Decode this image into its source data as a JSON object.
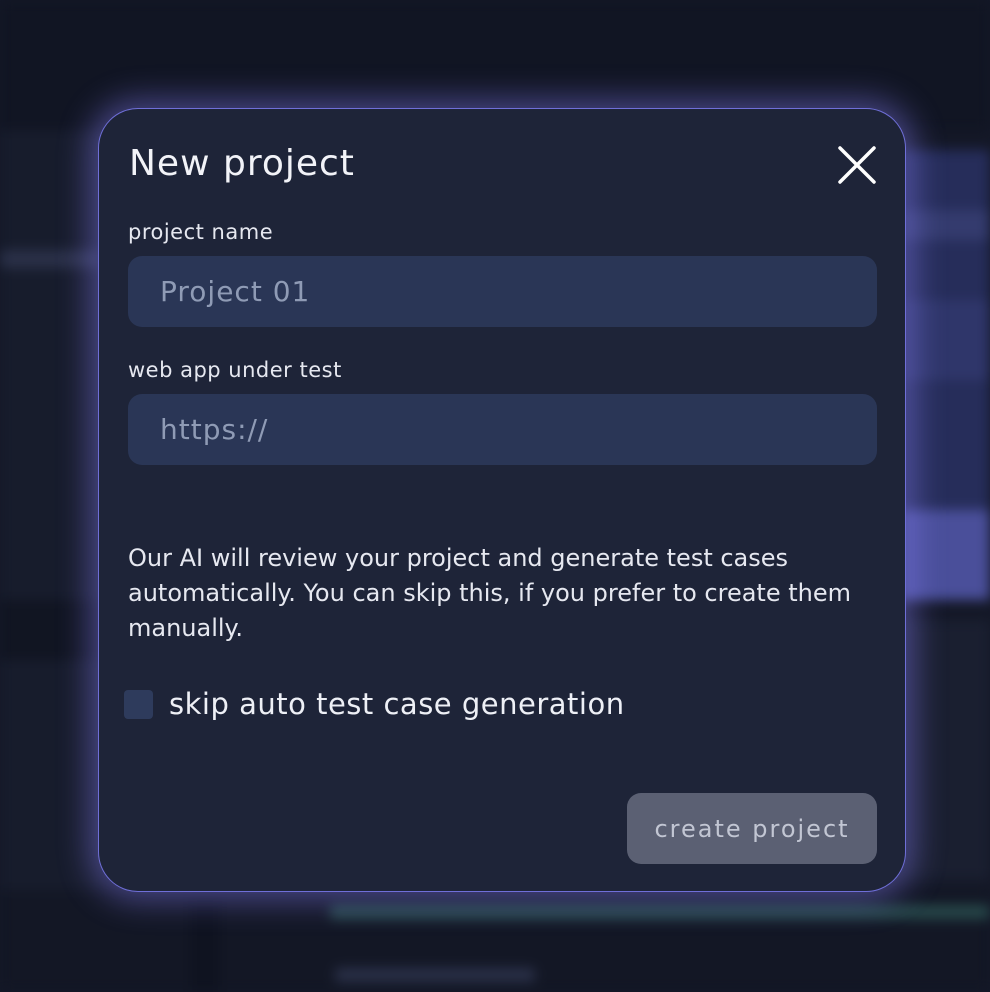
{
  "modal": {
    "title": "New project",
    "close_icon": "close-icon"
  },
  "project_name": {
    "label": "project name",
    "placeholder": "Project 01",
    "value": ""
  },
  "web_app": {
    "label": "web app under test",
    "placeholder": "https://",
    "value": ""
  },
  "description": "Our AI will review your project and generate test cases automatically. You can skip this, if you prefer to create them manually.",
  "skip_option": {
    "label": "skip auto test case generation",
    "checked": false
  },
  "create_button": {
    "label": "create project",
    "disabled": true
  },
  "colors": {
    "modal_bg": "#1e2438",
    "modal_border": "#6f6fd8",
    "input_bg": "#2a3656",
    "button_disabled_bg": "#5b6073"
  }
}
